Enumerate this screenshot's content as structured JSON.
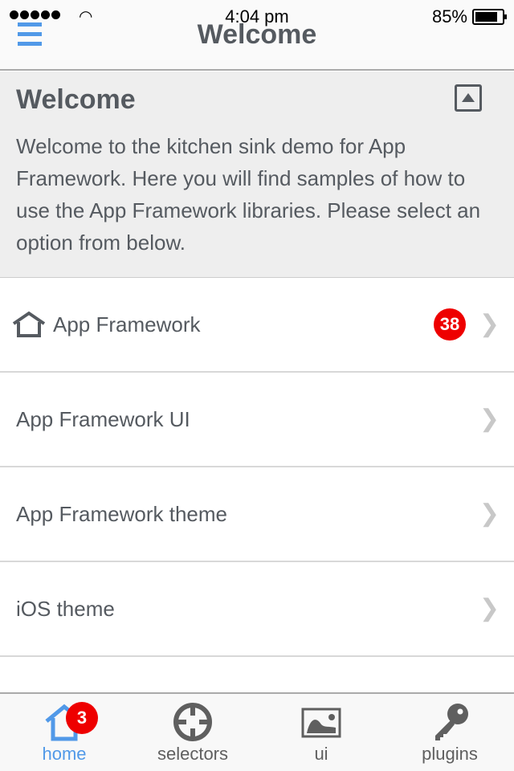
{
  "status": {
    "time": "4:04 pm",
    "battery": "85%",
    "battery_level": 0.85
  },
  "header": {
    "title": "Welcome"
  },
  "panel": {
    "title": "Welcome",
    "text": "Welcome to the kitchen sink demo for App Framework. Here you will find samples of how to use the App Framework libraries. Please select an option from below."
  },
  "list": [
    {
      "label": "App Framework",
      "icon": "home-icon",
      "badge": "38"
    },
    {
      "label": "App Framework UI"
    },
    {
      "label": "App Framework theme"
    },
    {
      "label": "iOS theme"
    }
  ],
  "tabs": [
    {
      "label": "home",
      "icon": "home-icon",
      "badge": "3",
      "active": true
    },
    {
      "label": "selectors",
      "icon": "crosshair-icon"
    },
    {
      "label": "ui",
      "icon": "image-icon"
    },
    {
      "label": "plugins",
      "icon": "key-icon"
    }
  ],
  "colors": {
    "accent": "#5199e8",
    "badge": "#ee0000",
    "panel": "#eeeeee"
  }
}
